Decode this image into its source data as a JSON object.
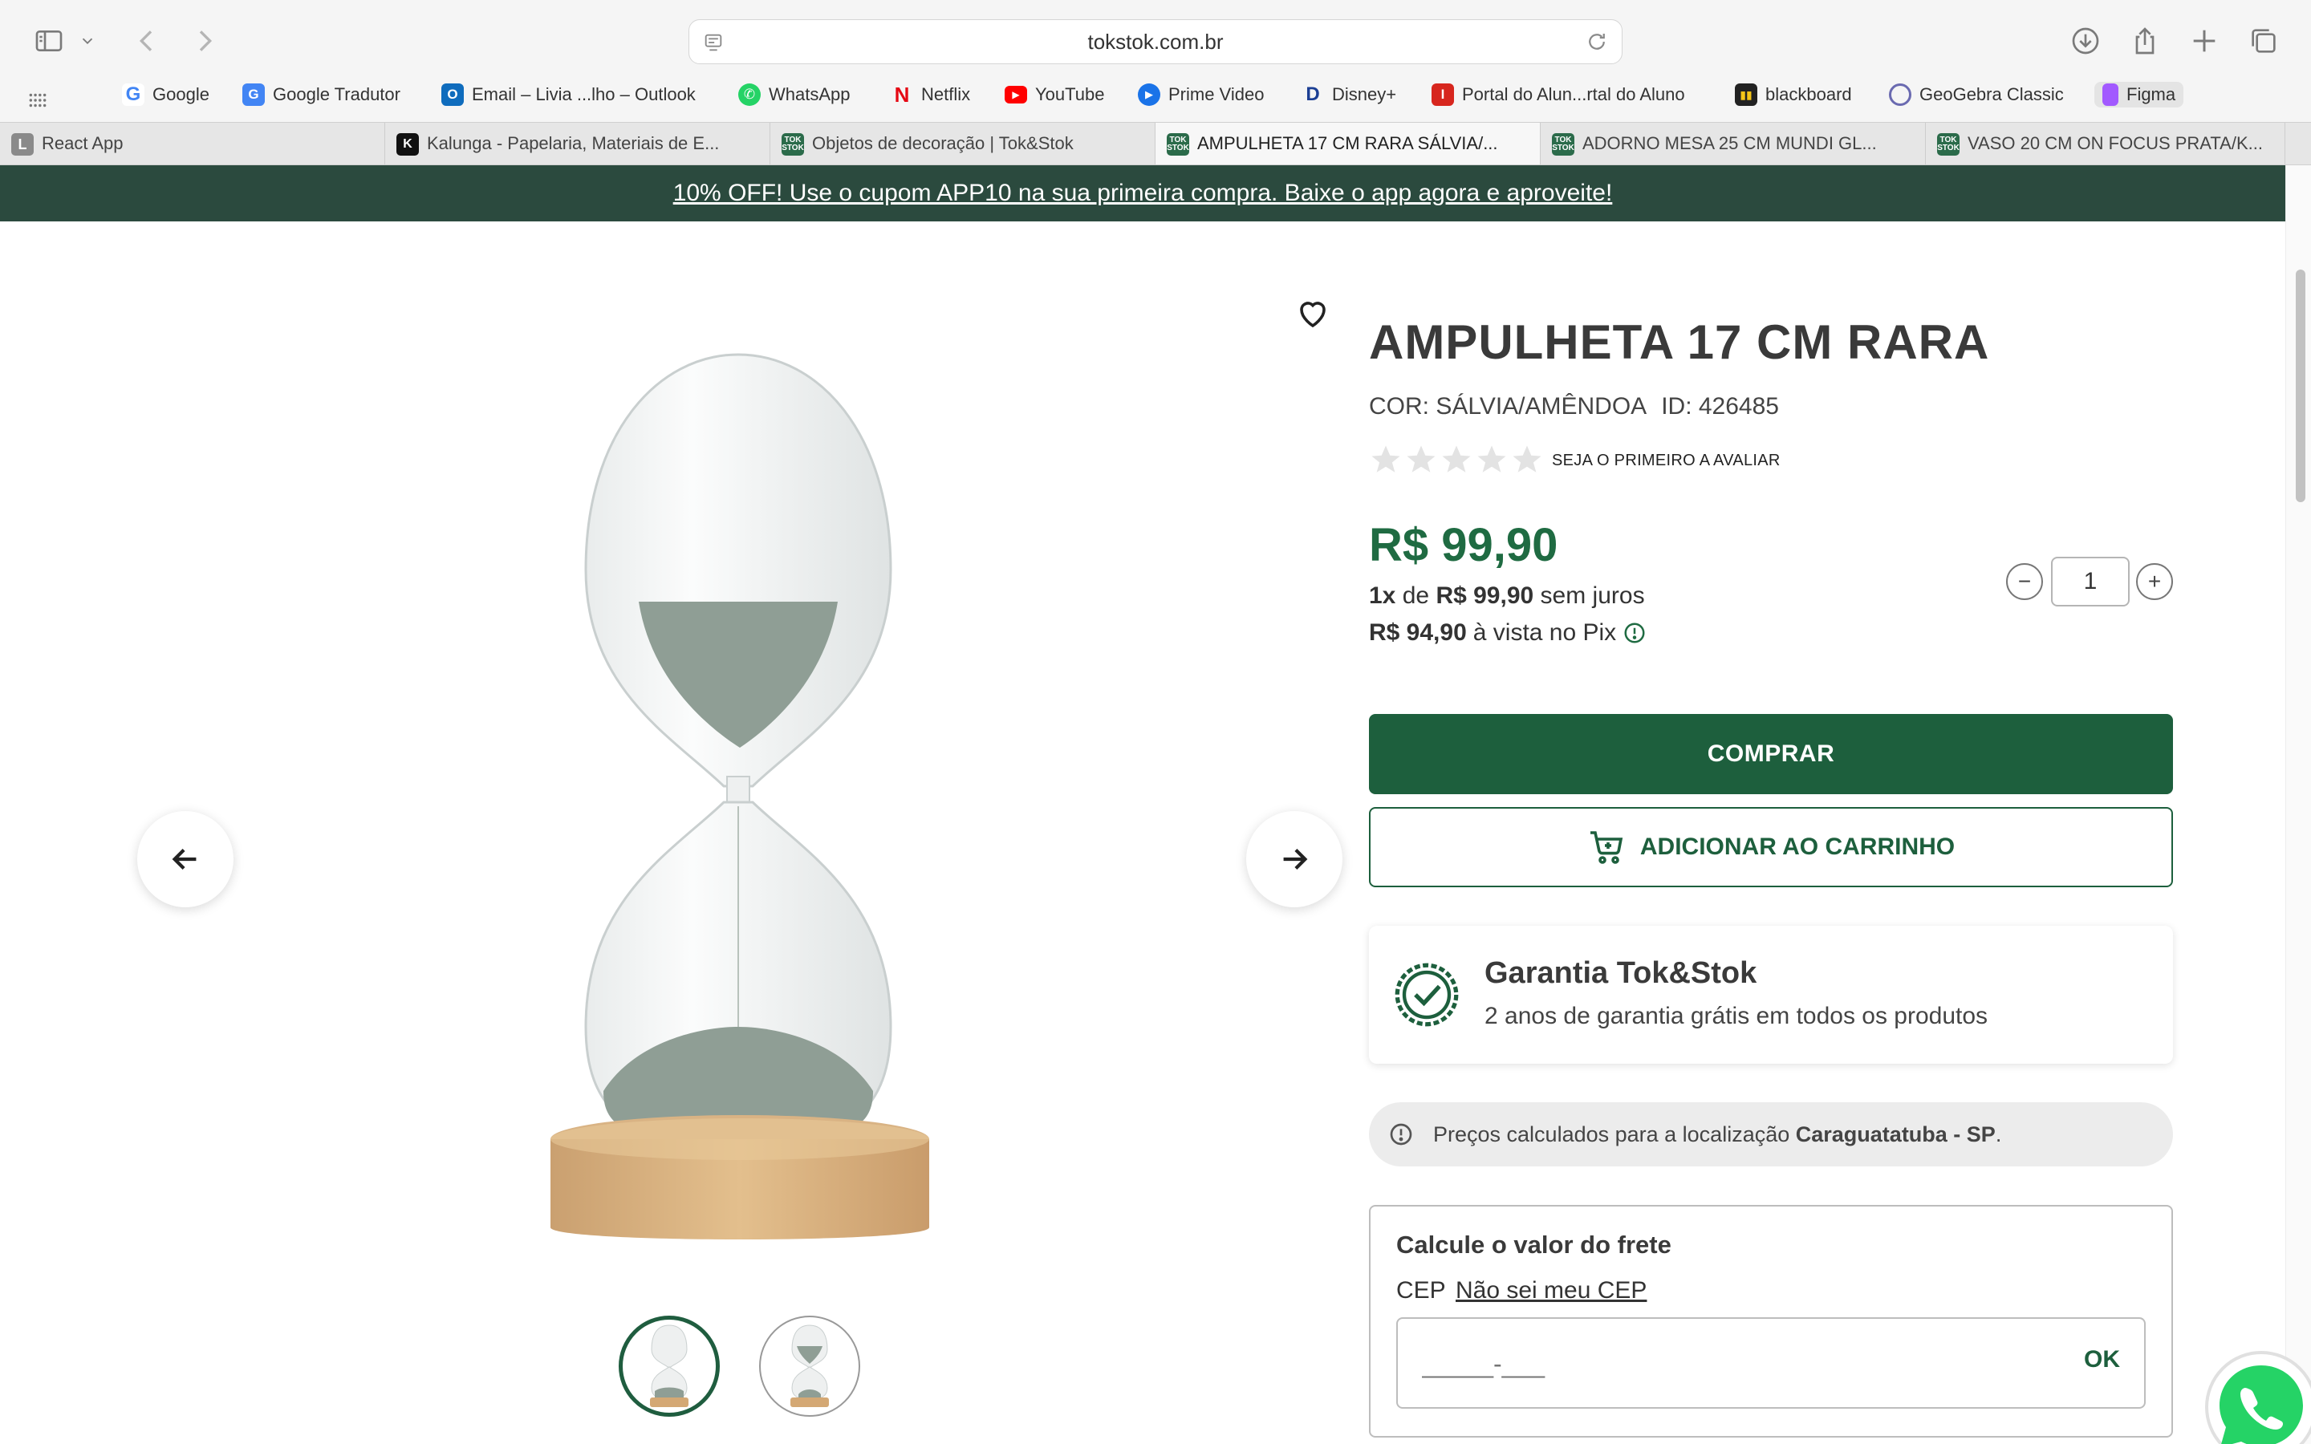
{
  "browser": {
    "url": "tokstok.com.br",
    "bookmarks": [
      {
        "label": "Google",
        "color": "#ffffff"
      },
      {
        "label": "Google Tradutor",
        "color": "#4285f4"
      },
      {
        "label": "Email – Livia ...lho – Outlook",
        "color": "#0f6cbd"
      },
      {
        "label": "WhatsApp",
        "color": "#25d366"
      },
      {
        "label": "Netflix",
        "color": "#e50914"
      },
      {
        "label": "YouTube",
        "color": "#ff0000"
      },
      {
        "label": "Prime Video",
        "color": "#1a73e8"
      },
      {
        "label": "Disney+",
        "color": "#1c3f94"
      },
      {
        "label": "Portal do Alun...rtal do Aluno",
        "color": "#d7261e"
      },
      {
        "label": "blackboard",
        "color": "#222222"
      },
      {
        "label": "GeoGebra Classic",
        "color": "#6a6ab0"
      },
      {
        "label": "Figma",
        "color": "#a259ff"
      }
    ],
    "tabs": [
      {
        "label": "React App"
      },
      {
        "label": "Kalunga - Papelaria, Materiais de E..."
      },
      {
        "label": "Objetos de decoração | Tok&Stok"
      },
      {
        "label": "AMPULHETA 17 CM RARA SÁLVIA/..."
      },
      {
        "label": "ADORNO MESA 25 CM MUNDI GL..."
      },
      {
        "label": "VASO 20 CM ON FOCUS PRATA/K..."
      }
    ],
    "active_tab": 3
  },
  "promo": {
    "text": "10% OFF! Use o cupom APP10 na sua primeira compra. Baixe o app agora e aproveite!",
    "bg_color": "#2b4a3e"
  },
  "product": {
    "title": "AMPULHETA 17 CM RARA",
    "color_label": "COR: SÁLVIA/AMÊNDOA",
    "id_label": "ID: 426485",
    "rating_stars": 0,
    "review_cta": "SEJA O PRIMEIRO A AVALIAR",
    "price": "R$ 99,90",
    "installments": {
      "count": "1x",
      "of": "de",
      "amount": "R$ 99,90",
      "suffix": "sem juros"
    },
    "pix": {
      "amount": "R$ 94,90",
      "suffix": "à vista no Pix"
    },
    "quantity": "1",
    "qty_minus": "−",
    "qty_plus": "+",
    "buy_label": "COMPRAR",
    "cart_label": "ADICIONAR AO CARRINHO",
    "thumbnails_active": 0,
    "accent_color": "#1d5f3d"
  },
  "warranty": {
    "title": "Garantia Tok&Stok",
    "text": "2 anos de garantia grátis em todos os produtos"
  },
  "location": {
    "prefix": "Preços calculados para a localização",
    "place": "Caraguatatuba - SP",
    "suffix": "."
  },
  "shipping": {
    "title": "Calcule o valor do frete",
    "cep_label": "CEP",
    "cep_help": "Não sei meu CEP",
    "cep_placeholder": "_____-___",
    "ok_label": "OK"
  }
}
